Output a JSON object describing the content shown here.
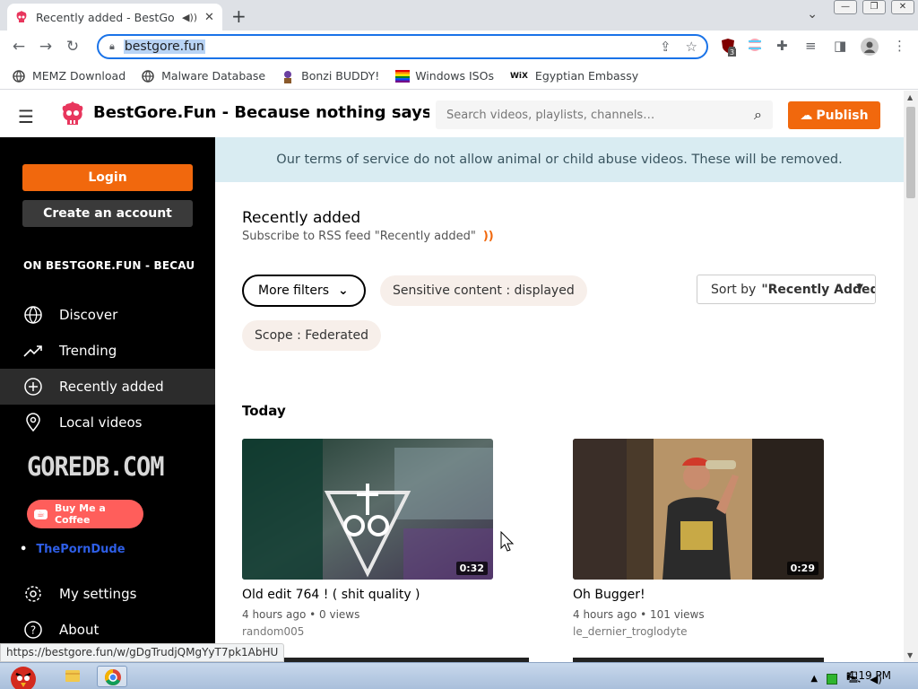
{
  "browser": {
    "tab_title": "Recently added - BestGore",
    "new_tab": "+",
    "url": "bestgore.fun",
    "status_url": "https://bestgore.fun/w/gDgTrudjQMgYyT7pk1AbHU",
    "extension_badge": "3"
  },
  "bookmarks": [
    {
      "label": "MEMZ Download",
      "icon": "globe-icon"
    },
    {
      "label": "Malware Database",
      "icon": "globe-icon"
    },
    {
      "label": "Bonzi BUDDY!",
      "icon": "bonzi-icon"
    },
    {
      "label": "Windows ISOs",
      "icon": "rainbow-flag-icon"
    },
    {
      "label": "Egyptian Embassy",
      "icon": "wix-icon"
    }
  ],
  "header": {
    "site_title": "BestGore.Fun - Because nothing says 'f...",
    "search_placeholder": "Search videos, playlists, channels…",
    "publish_label": "Publish"
  },
  "sidebar": {
    "login_label": "Login",
    "create_label": "Create an account",
    "section_title": "ON BESTGORE.FUN - BECAU...",
    "items": [
      {
        "label": "Discover",
        "icon": "globe-icon"
      },
      {
        "label": "Trending",
        "icon": "trending-icon"
      },
      {
        "label": "Recently added",
        "icon": "plus-circle-icon"
      },
      {
        "label": "Local videos",
        "icon": "location-icon"
      }
    ],
    "goredb": "GOREDB.COM",
    "coffee_label": "Buy Me a Coffee",
    "link_label": "ThePornDude",
    "bottom_items": [
      {
        "label": "My settings",
        "icon": "gear-icon"
      },
      {
        "label": "About",
        "icon": "help-icon"
      }
    ]
  },
  "banner": "Our terms of service do not allow animal or child abuse videos. These will be removed.",
  "main": {
    "heading": "Recently added",
    "rss_text": "Subscribe to RSS feed \"Recently added\"",
    "filters_label": "More filters",
    "sensitive_label": "Sensitive content : displayed",
    "scope_label": "Scope : Federated",
    "sort_prefix": "Sort by",
    "sort_value": "\"Recently Added\"",
    "section_today": "Today"
  },
  "videos": [
    {
      "title": "Old edit 764 ! ( shit quality )",
      "meta": "4 hours ago • 0 views",
      "account": "random005",
      "duration": "0:32"
    },
    {
      "title": "Oh Bugger!",
      "meta": "4 hours ago • 101 views",
      "account": "le_dernier_troglodyte",
      "duration": "0:29"
    }
  ],
  "taskbar": {
    "time": "4:19 PM"
  },
  "colors": {
    "accent": "#f1680d",
    "banner_bg": "#d9ecf2",
    "sidebar_bg": "#000000"
  }
}
